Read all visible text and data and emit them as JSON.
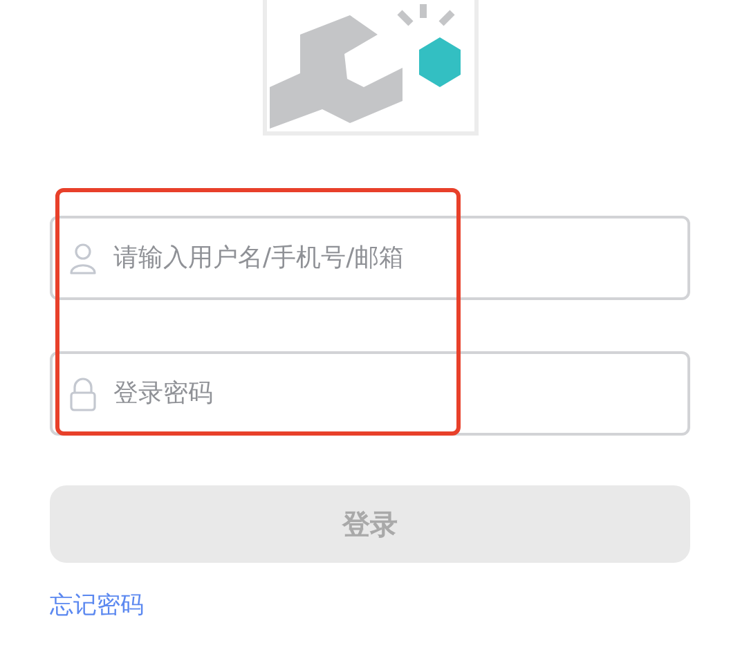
{
  "fields": [
    {
      "kind": "username",
      "placeholder": "请输入用户名/手机号/邮箱"
    },
    {
      "kind": "password",
      "placeholder": "登录密码"
    }
  ],
  "login_button": {
    "label": "登录",
    "disabled": true
  },
  "forgot_link": "忘记密码",
  "annotations": [
    {
      "kind": "box"
    }
  ]
}
